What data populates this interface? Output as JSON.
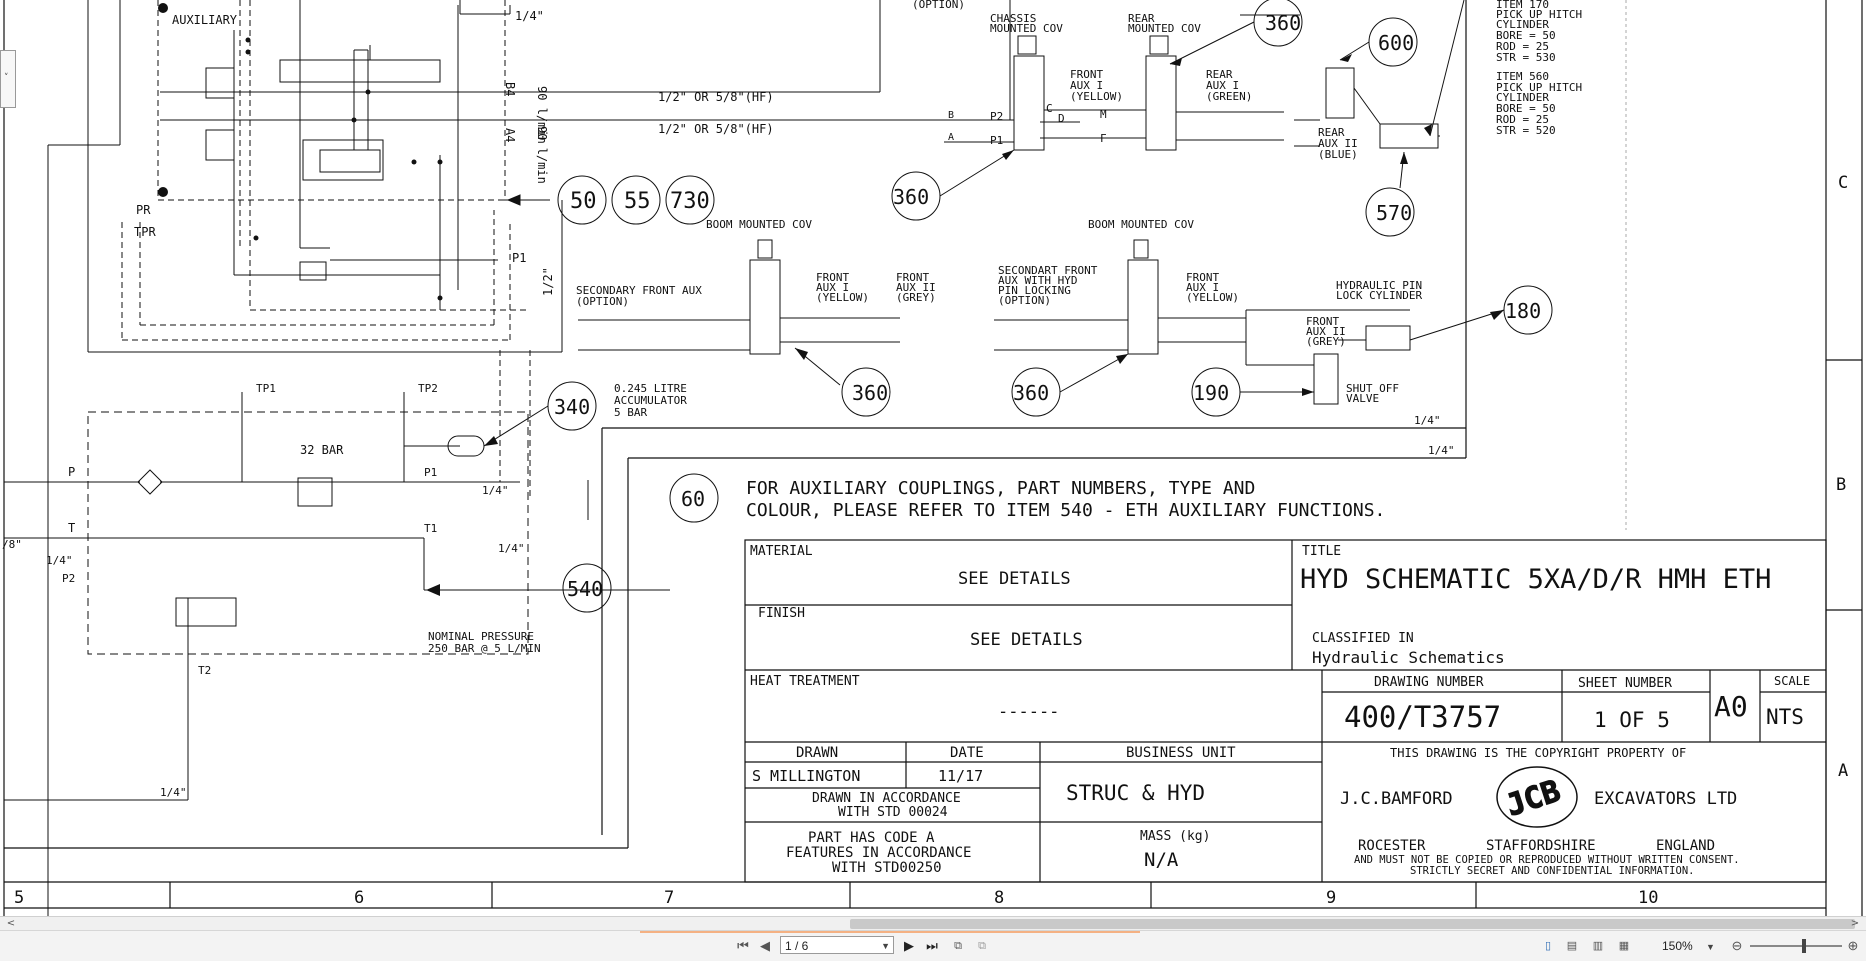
{
  "drawing": {
    "left_block": {
      "auxiliary": "AUXILIARY",
      "flow_top": "90 l/min",
      "flow_bottom": "90 l/min",
      "port_b4": "B4",
      "port_a4": "A4",
      "size_quarter": "1/4\"",
      "size_half": "1/2\"",
      "pr": "PR",
      "tpr": "TPR",
      "p1": "P1",
      "hose_1": "1/2\" OR 5/8\"(HF)",
      "hose_2": "1/2\" OR 5/8\"(HF)"
    },
    "callouts": {
      "c50": "50",
      "c55": "55",
      "c730": "730",
      "c340": "340",
      "c60": "60",
      "c540": "540",
      "c360_top": "360",
      "c360_left": "360",
      "c360_boom1": "360",
      "c360_boom2": "360",
      "c600": "600",
      "c570": "570",
      "c180": "180",
      "c190": "190"
    },
    "top_labels": {
      "option": "(OPTION)",
      "chassis_cov_1": "CHASSIS",
      "chassis_cov_2": "MOUNTED COV",
      "rear_cov_1": "REAR",
      "rear_cov_2": "MOUNTED COV",
      "front_aux_1": "FRONT",
      "front_aux_2": "AUX I",
      "front_aux_3": "(YELLOW)",
      "rear_aux1_1": "REAR",
      "rear_aux1_2": "AUX I",
      "rear_aux1_3": "(GREEN)",
      "rear_aux2_1": "REAR",
      "rear_aux2_2": "AUX II",
      "rear_aux2_3": "(BLUE)",
      "port_b": "B",
      "port_a": "A",
      "port_p2": "P2",
      "port_p1": "P1",
      "port_c": "C",
      "port_d": "D",
      "port_m": "M",
      "port_f": "F"
    },
    "item_notes": {
      "item170_1": "ITEM 170",
      "item170_2": "PICK UP HITCH",
      "item170_3": "CYLINDER",
      "item170_4": "BORE  =  50",
      "item170_5": "ROD   =  25",
      "item170_6": "STR   = 530",
      "item560_1": "ITEM 560",
      "item560_2": "PICK UP HITCH",
      "item560_3": "CYLINDER",
      "item560_4": "BORE  =  50",
      "item560_5": "ROD   =  25",
      "item560_6": "STR   = 520"
    },
    "boom_labels": {
      "boom_cov_1": "BOOM MOUNTED COV",
      "boom_cov_2": "BOOM MOUNTED COV",
      "sec_front_1": "SECONDARY FRONT AUX",
      "sec_front_2": "(OPTION)",
      "front_aux_yellow_1": "FRONT",
      "front_aux_yellow_2": "AUX I",
      "front_aux_yellow_3": "(YELLOW)",
      "front_aux_grey_1": "FRONT",
      "front_aux_grey_2": "AUX II",
      "front_aux_grey_3": "(GREY)",
      "secondart_1": "SECONDART FRONT",
      "secondart_2": "AUX WITH HYD",
      "secondart_3": "PIN LOCKING",
      "secondart_4": "(OPTION)",
      "front_aux_y2_1": "FRONT",
      "front_aux_y2_2": "AUX I",
      "front_aux_y2_3": "(YELLOW)",
      "hyd_pin_1": "HYDRAULIC PIN",
      "hyd_pin_2": "LOCK CYLINDER",
      "front_aux_g2_1": "FRONT",
      "front_aux_g2_2": "AUX II",
      "front_aux_g2_3": "(GREY)",
      "shut_off_1": "SHUT OFF",
      "shut_off_2": "VALVE",
      "quarter_1": "1/4\"",
      "quarter_2": "1/4\""
    },
    "lower_left": {
      "tp1": "TP1",
      "tp2": "TP2",
      "acc_1": "0.245 LITRE",
      "acc_2": "ACCUMULATOR",
      "acc_3": "5 BAR",
      "bar32": "32 BAR",
      "p": "P",
      "t": "T",
      "p1": "P1",
      "t1": "T1",
      "p2": "P2",
      "t2": "T2",
      "q1": "1/4\"",
      "q2": "1/4\"",
      "q3": "1/4\"",
      "q4": "1/4\"",
      "eighth": "/8\"",
      "nominal_1": "NOMINAL PRESSURE",
      "nominal_2": "250 BAR @ 5 L/MIN"
    },
    "note": {
      "line1": "FOR AUXILIARY COUPLINGS, PART NUMBERS, TYPE AND",
      "line2": "COLOUR, PLEASE REFER TO ITEM 540 - ETH AUXILIARY FUNCTIONS."
    },
    "title_block": {
      "material_label": "MATERIAL",
      "material_value": "SEE DETAILS",
      "finish_label": "FINISH",
      "finish_value": "SEE DETAILS",
      "heat_label": "HEAT TREATMENT",
      "heat_value": "------",
      "title_label": "TITLE",
      "title_value": "HYD SCHEMATIC 5XA/D/R HMH ETH",
      "classified_label": "CLASSIFIED IN",
      "classified_value": "Hydraulic Schematics",
      "drawing_number_label": "DRAWING NUMBER",
      "drawing_number_value": "400/T3757",
      "sheet_label": "SHEET NUMBER",
      "sheet_value": "1 OF 5",
      "size_value": "A0",
      "scale_label": "SCALE",
      "scale_value": "NTS",
      "drawn_label": "DRAWN",
      "drawn_value": "S MILLINGTON",
      "date_label": "DATE",
      "date_value": "11/17",
      "accordance_1": "DRAWN IN ACCORDANCE",
      "accordance_2": "WITH STD 00024",
      "bu_label": "BUSINESS UNIT",
      "bu_value": "STRUC & HYD",
      "code_1": "PART HAS CODE  A",
      "code_2": "FEATURES IN ACCORDANCE",
      "code_3": "WITH STD00250",
      "mass_label": "MASS (kg)",
      "mass_value": "N/A",
      "copyright_top": "THIS DRAWING IS THE COPYRIGHT PROPERTY OF",
      "company_left": "J.C.BAMFORD",
      "company_right": "EXCAVATORS LTD",
      "logo": "JCB",
      "loc_1": "ROCESTER",
      "loc_2": "STAFFORDSHIRE",
      "loc_3": "ENGLAND",
      "copy_1": "AND MUST NOT BE COPIED OR REPRODUCED WITHOUT WRITTEN CONSENT.",
      "copy_2": "STRICTLY SECRET AND CONFIDENTIAL INFORMATION."
    },
    "zones": {
      "col_5": "5",
      "col_6": "6",
      "col_7": "7",
      "col_8": "8",
      "col_9": "9",
      "col_10": "10",
      "row_c": "C",
      "row_b": "B",
      "row_a": "A"
    }
  },
  "viewer_toolbar": {
    "page_value": "1 / 6",
    "zoom_value": "150%"
  }
}
